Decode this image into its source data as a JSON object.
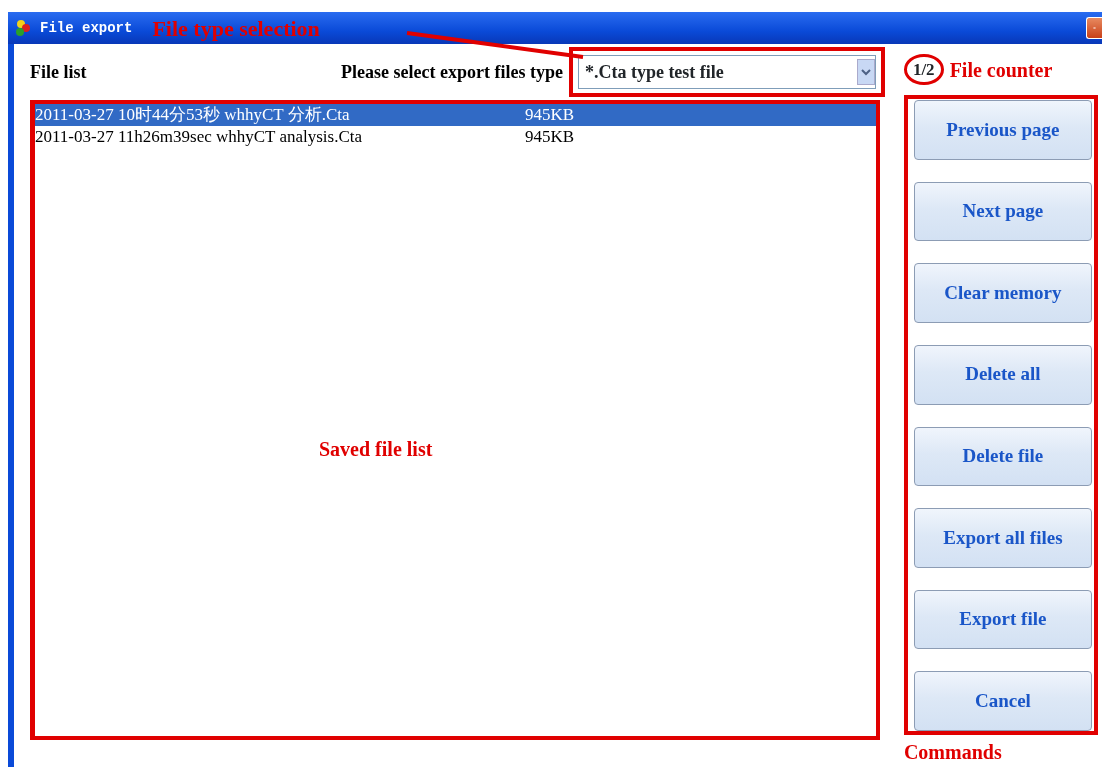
{
  "window": {
    "title": "File export"
  },
  "file_list_label": "File list",
  "type_selector": {
    "label": "Please select export files type",
    "value": "*.Cta type test file"
  },
  "file_counter": "1/2",
  "files": [
    {
      "name": "2011-03-27 10时44分53秒 whhyCT 分析.Cta",
      "size": "945KB",
      "selected": true
    },
    {
      "name": "2011-03-27 11h26m39sec whhyCT analysis.Cta",
      "size": "945KB",
      "selected": false
    }
  ],
  "commands": [
    "Previous page",
    "Next page",
    "Clear memory",
    "Delete all",
    "Delete file",
    "Export all files",
    "Export file",
    "Cancel"
  ],
  "annotations": {
    "file_type_selection": "File type selection",
    "file_counter": "File counter",
    "saved_file_list": "Saved file list",
    "commands": "Commands"
  }
}
